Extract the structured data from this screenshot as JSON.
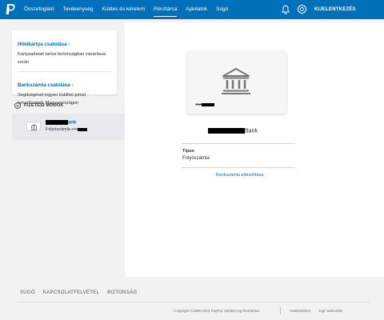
{
  "nav": {
    "items": [
      {
        "label": "Összefoglaló",
        "active": false
      },
      {
        "label": "Tevékenység",
        "active": false
      },
      {
        "label": "Küldés és kérelem",
        "active": false
      },
      {
        "label": "Pénztárca",
        "active": true
      },
      {
        "label": "Ajánlatok",
        "active": false
      },
      {
        "label": "Súgó",
        "active": false
      }
    ],
    "logout": "KIJELENTKEZÉS",
    "icons": [
      "paypal-logo-icon",
      "bell-icon",
      "gear-icon"
    ]
  },
  "sidebar": {
    "link_card": {
      "card": {
        "title": "Hitelkártya csatolása",
        "desc": "Kártyaadatait tartsa biztonságban vásárlásai során"
      },
      "bank": {
        "title": "Bankszámla csatolása",
        "desc": "Segítségével ingyen küldhet pénzt ismerőseinek Magyarországon"
      }
    },
    "methods_label": "FIZETÉSI MÓDOK",
    "method": {
      "name_suffix": "ank",
      "sub": "Folyószámla",
      "sub_dots": "••••"
    }
  },
  "detail": {
    "card_dots": "••••",
    "bank_suffix": "Bank",
    "type_label": "Típus",
    "type_value": "Folyószámla",
    "remove_link": "Bankszámla eltávolítása"
  },
  "footer": {
    "links": [
      "SÚGÓ",
      "KAPCSOLATFELVÉTEL",
      "BIZTONSÁG"
    ],
    "copyright": "Copyright ©1999-2016 PayPal. Minden jog fenntartva.",
    "legal1": "Adatvédelem",
    "legal2": "Jogi tudnivalók"
  },
  "colors": {
    "brand": "#0070ba",
    "background": "#f2f2f2",
    "selected_row": "#e6e9ee"
  }
}
